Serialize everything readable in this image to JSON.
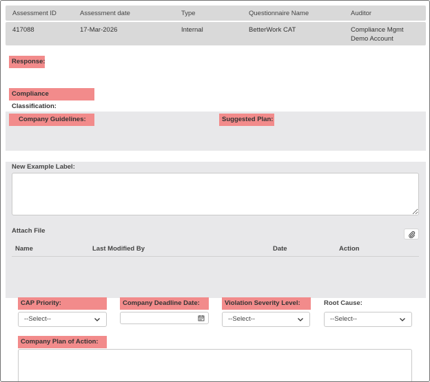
{
  "header": {
    "columns": [
      "Assessment ID",
      "Assessment date",
      "Type",
      "Questionnaire Name",
      "Auditor"
    ],
    "values": [
      "417088",
      "17-Mar-2026",
      "Internal",
      "BetterWork CAT",
      "Compliance Mgmt"
    ],
    "auditor_line2": "Demo Account"
  },
  "labels": {
    "response": "Response:",
    "compliance_classification": "Compliance Classification:",
    "company_guidelines": "Company Guidelines:",
    "suggested_plan": "Suggested Plan:",
    "new_example_label": "New Example Label:",
    "attach_file": "Attach File",
    "cap_priority": "CAP Priority:",
    "company_deadline_date": "Company Deadline Date:",
    "violation_severity_level": "Violation Severity Level:",
    "root_cause": "Root Cause:",
    "company_plan_of_action": "Company Plan of Action:"
  },
  "attachments_table": {
    "columns": [
      "Name",
      "Last Modified By",
      "Date",
      "Action"
    ]
  },
  "selects": {
    "cap_priority": "--Select--",
    "violation_severity_level": "--Select--",
    "root_cause": "--Select--"
  },
  "colors": {
    "highlight": "#f28b8b",
    "header_bg": "#d9d9d9",
    "panel_bg": "#e8e8ea"
  }
}
